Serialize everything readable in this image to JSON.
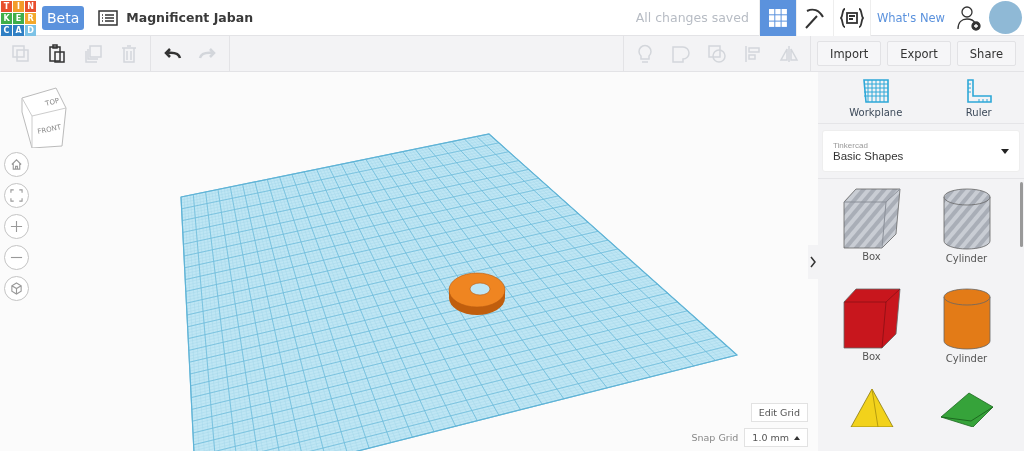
{
  "logo": {
    "letters": [
      {
        "char": "T",
        "color": "#e8502f"
      },
      {
        "char": "I",
        "color": "#f39c2b"
      },
      {
        "char": "N",
        "color": "#e8502f"
      },
      {
        "char": "K",
        "color": "#3fae49"
      },
      {
        "char": "E",
        "color": "#3fae49"
      },
      {
        "char": "R",
        "color": "#f3a82b"
      },
      {
        "char": "C",
        "color": "#2f7fc4"
      },
      {
        "char": "A",
        "color": "#2f7fc4"
      },
      {
        "char": "D",
        "color": "#7cc2e6"
      }
    ]
  },
  "badge": "Beta",
  "title": "Magnificent Jaban",
  "save_status": "All changes saved",
  "views": [
    {
      "kind": "grid",
      "selected": true
    },
    {
      "kind": "pickaxe",
      "selected": false
    },
    {
      "kind": "code",
      "selected": false
    }
  ],
  "whats_new": "What's New",
  "edit_tools": [
    {
      "kind": "copy",
      "disabled": true
    },
    {
      "kind": "paste",
      "disabled": false
    },
    {
      "kind": "duplicate",
      "disabled": true
    },
    {
      "kind": "delete",
      "disabled": true
    }
  ],
  "history_tools": [
    {
      "kind": "undo",
      "disabled": false
    },
    {
      "kind": "redo",
      "disabled": true
    }
  ],
  "shape_tools": [
    {
      "kind": "bulb",
      "disabled": true
    },
    {
      "kind": "solid",
      "disabled": true
    },
    {
      "kind": "hole",
      "disabled": true
    },
    {
      "kind": "align",
      "disabled": true
    },
    {
      "kind": "mirror",
      "disabled": true
    }
  ],
  "actions": [
    "Import",
    "Export",
    "Share"
  ],
  "view_cube": {
    "top": "TOP",
    "front": "FRONT"
  },
  "nav_controls": [
    {
      "kind": "home"
    },
    {
      "kind": "fit"
    },
    {
      "kind": "zoom-in"
    },
    {
      "kind": "zoom-out"
    },
    {
      "kind": "perspective"
    }
  ],
  "edit_grid": "Edit Grid",
  "snap_grid": {
    "label": "Snap Grid",
    "value": "1.0 mm"
  },
  "panel_tools": [
    {
      "kind": "workplane",
      "label": "Workplane"
    },
    {
      "kind": "ruler",
      "label": "Ruler"
    }
  ],
  "library": {
    "source": "Tinkercad",
    "value": "Basic Shapes"
  },
  "shapes": [
    {
      "kind": "box",
      "label": "Box",
      "color": "#c9cdd4",
      "hole": true
    },
    {
      "kind": "cylinder",
      "label": "Cylinder",
      "color": "#c9cdd4",
      "hole": true
    },
    {
      "kind": "box",
      "label": "Box",
      "color": "#c8161d",
      "hole": false
    },
    {
      "kind": "cylinder",
      "label": "Cylinder",
      "color": "#e37b17",
      "hole": false
    },
    {
      "kind": "pyramid",
      "color": "#f2d21b",
      "hole": false
    },
    {
      "kind": "roof",
      "color": "#36a33a",
      "hole": false
    }
  ]
}
